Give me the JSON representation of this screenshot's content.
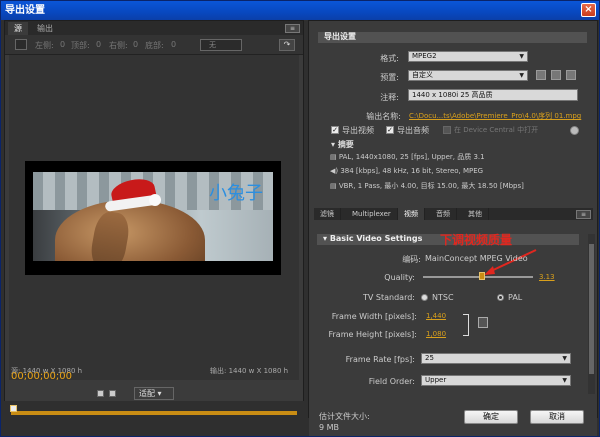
{
  "window": {
    "title": "导出设置",
    "close": "×"
  },
  "left": {
    "tabs": [
      "源",
      "输出"
    ],
    "toolbar": {
      "left": "左侧:",
      "left_v": "0",
      "top": "顶部:",
      "top_v": "0",
      "right": "右侧:",
      "right_v": "0",
      "bottom": "底部:",
      "bottom_v": "0",
      "crop_mode": "无"
    },
    "caption": "小兔子",
    "source_dims": "源: 1440 w X 1080 h",
    "output_dims": "输出: 1440 w X 1080 h",
    "timecode": "00;00;00;00",
    "fit": "适配"
  },
  "right": {
    "section_export": "导出设置",
    "format_label": "格式:",
    "format_value": "MPEG2",
    "preset_label": "预置:",
    "preset_value": "自定义",
    "comment_label": "注释:",
    "comment_value": "1440 x 1080i 25 高品质",
    "output_label": "输出名称:",
    "output_value": "C:\\Docu...ts\\Adobe\\Premiere_Pro\\4.0\\序列 01.mpg",
    "export_video": "导出视频",
    "export_audio": "导出音频",
    "device_central": "在 Device Central 中打开",
    "summary_title": "摘要",
    "summary_lines": [
      "PAL, 1440x1080, 25 [fps], Upper, 品质 3.1",
      "384 [kbps], 48 kHz, 16 bit, Stereo, MPEG",
      "VBR, 1 Pass, 最小 4.00, 目标 15.00, 最大 18.50 [Mbps]"
    ],
    "tabs": [
      "滤镜",
      "Multiplexer",
      "视频",
      "音频",
      "其他"
    ],
    "section_video": "Basic Video Settings",
    "annotation": "下调视频质量",
    "codec_label": "编码:",
    "codec_value": "MainConcept MPEG Video",
    "quality_label": "Quality:",
    "quality_value": "3.13",
    "tv_label": "TV Standard:",
    "tv_ntsc": "NTSC",
    "tv_pal": "PAL",
    "fw_label": "Frame Width [pixels]:",
    "fw_value": "1,440",
    "fh_label": "Frame Height [pixels]:",
    "fh_value": "1,080",
    "fr_label": "Frame Rate [fps]:",
    "fr_value": "25",
    "fo_label": "Field Order:",
    "fo_value": "Upper",
    "est_label": "估计文件大小:",
    "est_value": "9 MB",
    "ok": "确定",
    "cancel": "取消"
  },
  "colors": {
    "accent": "#d9a01c",
    "title_blue": "#0848bf",
    "annotation": "#e0271f"
  }
}
